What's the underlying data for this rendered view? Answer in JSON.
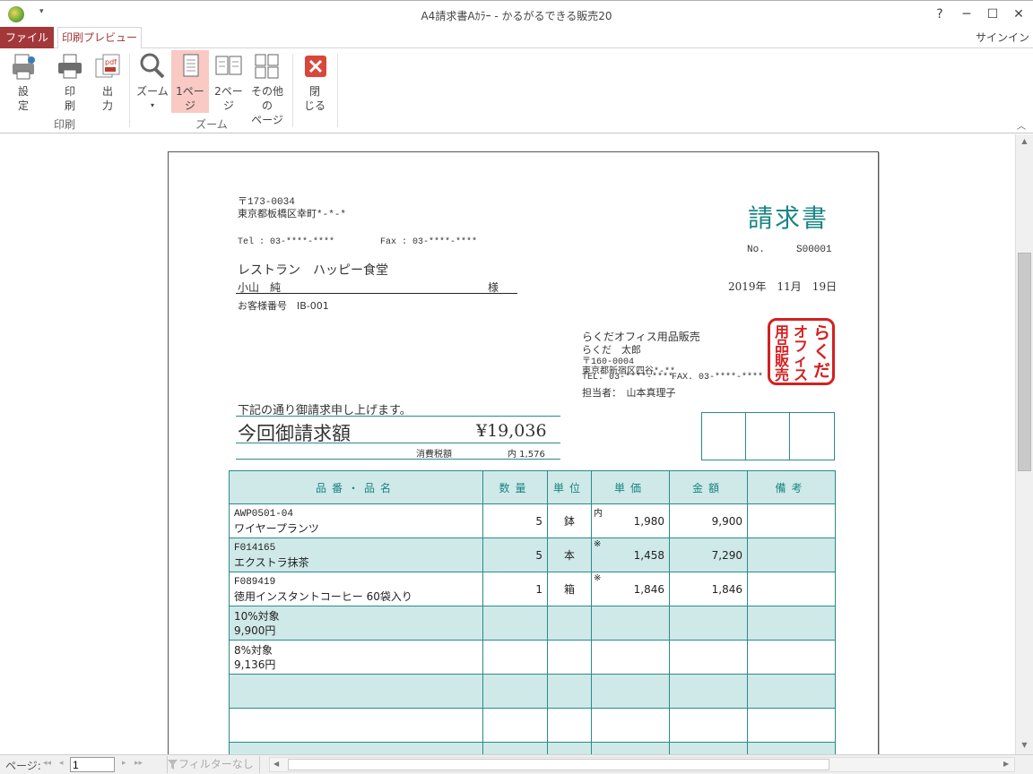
{
  "window": {
    "title": "A4請求書Aｶﾗｰ - かるがるできる販売20",
    "help": "?",
    "minimize": "─",
    "maximize": "☐",
    "close": "✕",
    "qa_arrow": "▾"
  },
  "tabs": {
    "file": "ファイル",
    "print_preview": "印刷プレビュー",
    "signin": "サインイン"
  },
  "ribbon": {
    "settings": {
      "line1": "設",
      "line2": "定"
    },
    "print": {
      "line1": "印",
      "line2": "刷"
    },
    "output": {
      "line1": "出",
      "line2": "力"
    },
    "print_group": "印刷",
    "zoom": {
      "label": "ズーム",
      "arrow": "▾"
    },
    "one_page": {
      "line1": "1ペー",
      "line2": "ジ"
    },
    "two_page": {
      "line1": "2ペー",
      "line2": "ジ"
    },
    "other_pages": {
      "line1": "その他の",
      "line2": "ページ",
      "arrow": "▾"
    },
    "zoom_group": "ズーム",
    "close": {
      "line1": "閉",
      "line2": "じる"
    },
    "collapse": "︿"
  },
  "invoice": {
    "sender_zip": "〒173-0034",
    "sender_address": "東京都板橋区幸町*-*-*",
    "sender_tel": "Tel : 03-****-****",
    "sender_fax": "Fax : 03-****-****",
    "title": "請求書",
    "no_label": "No.",
    "no_value": "S00001",
    "customer_name": "レストラン　ハッピー食堂",
    "contact_name": "小山　純",
    "honorific": "様",
    "date": "2019年　11月　19日",
    "customer_no": "お客様番号　IB-001",
    "issuer_name": "らくだオフィス用品販売",
    "issuer_person": "らくだ　太郎",
    "issuer_zip": "〒160-0004",
    "issuer_address": "東京都新宿区四谷*-**",
    "issuer_tel": "TEL. 03-****-****",
    "issuer_fax": "FAX. 03-****-****",
    "staff": "担当者：　山本真理子",
    "stamp_chars": [
      "ら",
      "く",
      "だ",
      "オ",
      "フ",
      "ィ",
      "ス",
      "用",
      "品",
      "販",
      "売"
    ],
    "intro": "下記の通り御請求申し上げます。",
    "amount_label": "今回御請求額",
    "amount_value": "¥19,036",
    "tax_label": "消費税額",
    "tax_value": "内 1,576",
    "headers": {
      "item": "品番・品名",
      "qty": "数量",
      "unit": "単位",
      "price": "単価",
      "amount": "金額",
      "note": "備考"
    },
    "rows": [
      {
        "code": "AWP0501-04",
        "name": "ワイヤープランツ",
        "qty": "5",
        "unit": "鉢",
        "mark": "内",
        "price": "1,980",
        "amount": "9,900"
      },
      {
        "code": "F014165",
        "name": "エクストラ抹茶",
        "qty": "5",
        "unit": "本",
        "mark": "※",
        "price": "1,458",
        "amount": "7,290"
      },
      {
        "code": "F089419",
        "name": "徳用インスタントコーヒー 60袋入り",
        "qty": "1",
        "unit": "箱",
        "mark": "※",
        "price": "1,846",
        "amount": "1,846"
      }
    ],
    "summary10_label": "10%対象",
    "summary10_value": "9,900円",
    "summary8_label": "8%対象",
    "summary8_value": "9,136円"
  },
  "statusbar": {
    "page_label": "ページ:",
    "page_value": "1",
    "filter": "フィルターなし",
    "first": "◂◂",
    "prev": "◂",
    "next": "▸",
    "last": "▸▸"
  }
}
